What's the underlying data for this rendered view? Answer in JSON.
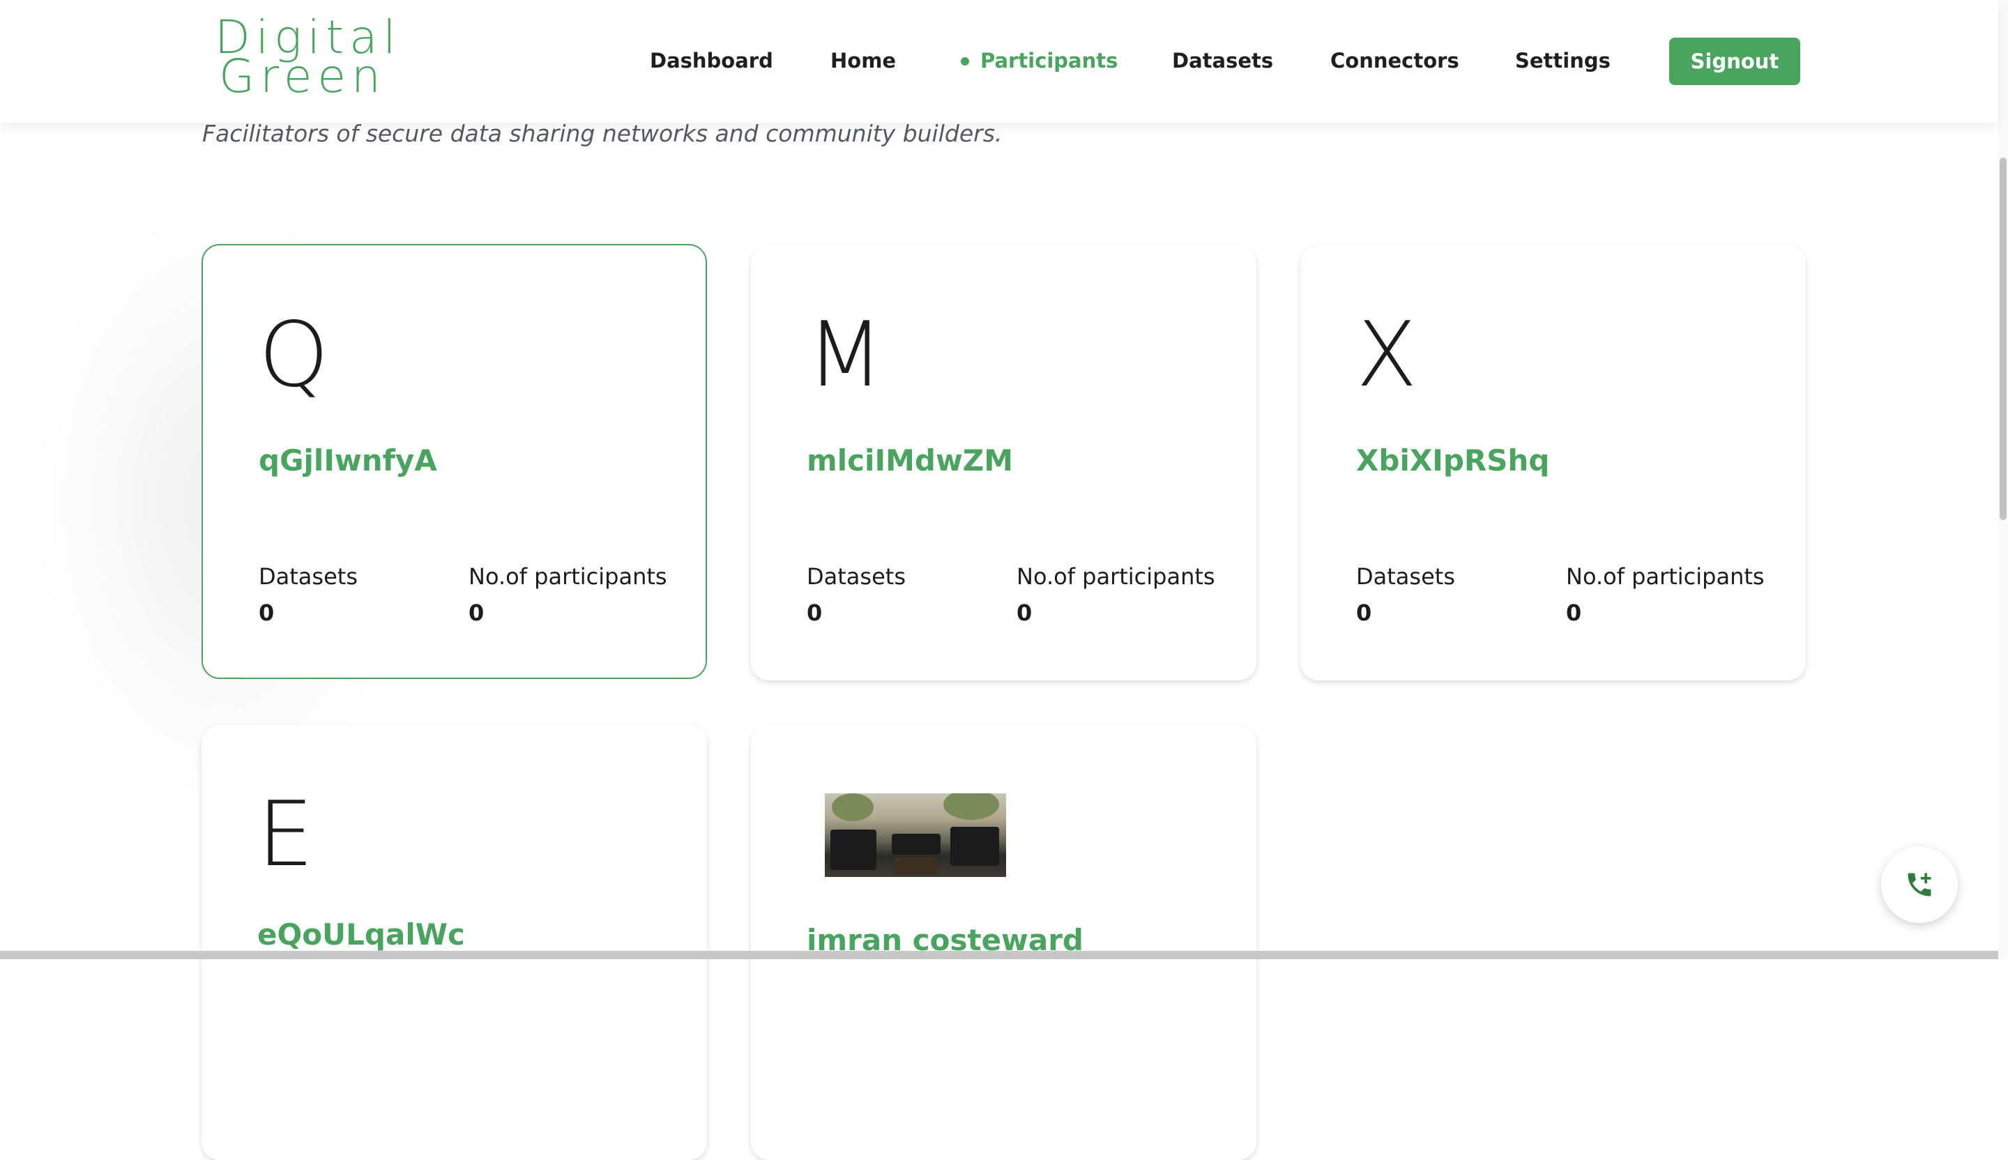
{
  "brand": {
    "logo_line1": "Digital",
    "logo_line2": "Green",
    "color": "#4aa35f"
  },
  "nav": {
    "items": [
      {
        "label": "Dashboard"
      },
      {
        "label": "Home"
      },
      {
        "label": "Participants",
        "active": true
      },
      {
        "label": "Datasets"
      },
      {
        "label": "Connectors"
      },
      {
        "label": "Settings"
      }
    ],
    "signout_label": "Signout"
  },
  "tagline": "Facilitators of secure data sharing networks and community builders.",
  "cards": [
    {
      "letter": "Q",
      "name": "qGjlIwnfyA",
      "datasets_label": "Datasets",
      "datasets": "0",
      "participants_label": "No.of participants",
      "participants": "0",
      "selected": true
    },
    {
      "letter": "M",
      "name": "mlciIMdwZM",
      "datasets_label": "Datasets",
      "datasets": "0",
      "participants_label": "No.of participants",
      "participants": "0"
    },
    {
      "letter": "X",
      "name": "XbiXIpRShq",
      "datasets_label": "Datasets",
      "datasets": "0",
      "participants_label": "No.of participants",
      "participants": "0"
    },
    {
      "letter": "E",
      "name": "eQoULqalWc"
    },
    {
      "image": "outdoor-furniture-photo",
      "name": "imran costeward"
    }
  ],
  "call_button_icon": "phone-add-icon"
}
